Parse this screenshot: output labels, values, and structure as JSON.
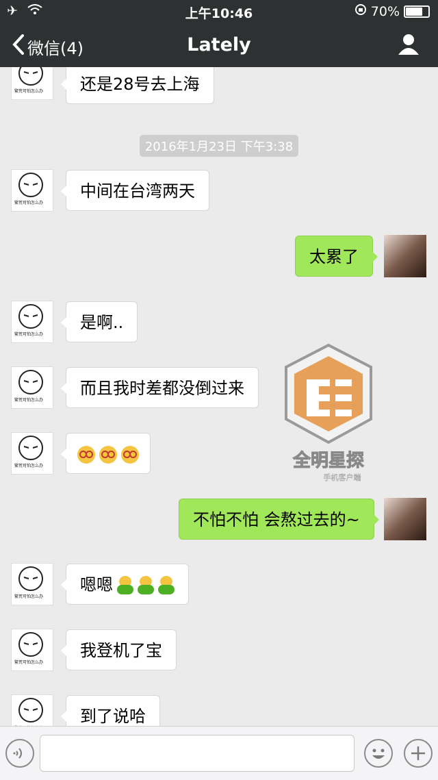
{
  "status_bar": {
    "time": "上午10:46",
    "battery": "70%"
  },
  "nav": {
    "back_label": "微信(4)",
    "title": "Lately"
  },
  "timestamp": "2016年1月23日 下午3:38",
  "messages": [
    {
      "text": "还是28号去上海"
    },
    {
      "text": "中间在台湾两天"
    },
    {
      "text": "太累了"
    },
    {
      "text": "是啊.."
    },
    {
      "text": "而且我时差都没倒过来"
    },
    {
      "text": "不怕不怕 会熬过去的~"
    },
    {
      "text": "嗯嗯"
    },
    {
      "text": "我登机了宝"
    },
    {
      "text": "到了说哈"
    }
  ],
  "avatar_caption": "繁荒可怕怎么办",
  "watermark": {
    "title": "全明星探",
    "subtitle": "手机客户端"
  },
  "colors": {
    "bar": "#2e3132",
    "chat_bg": "#ebebeb",
    "outgoing": "#a0e75a"
  }
}
